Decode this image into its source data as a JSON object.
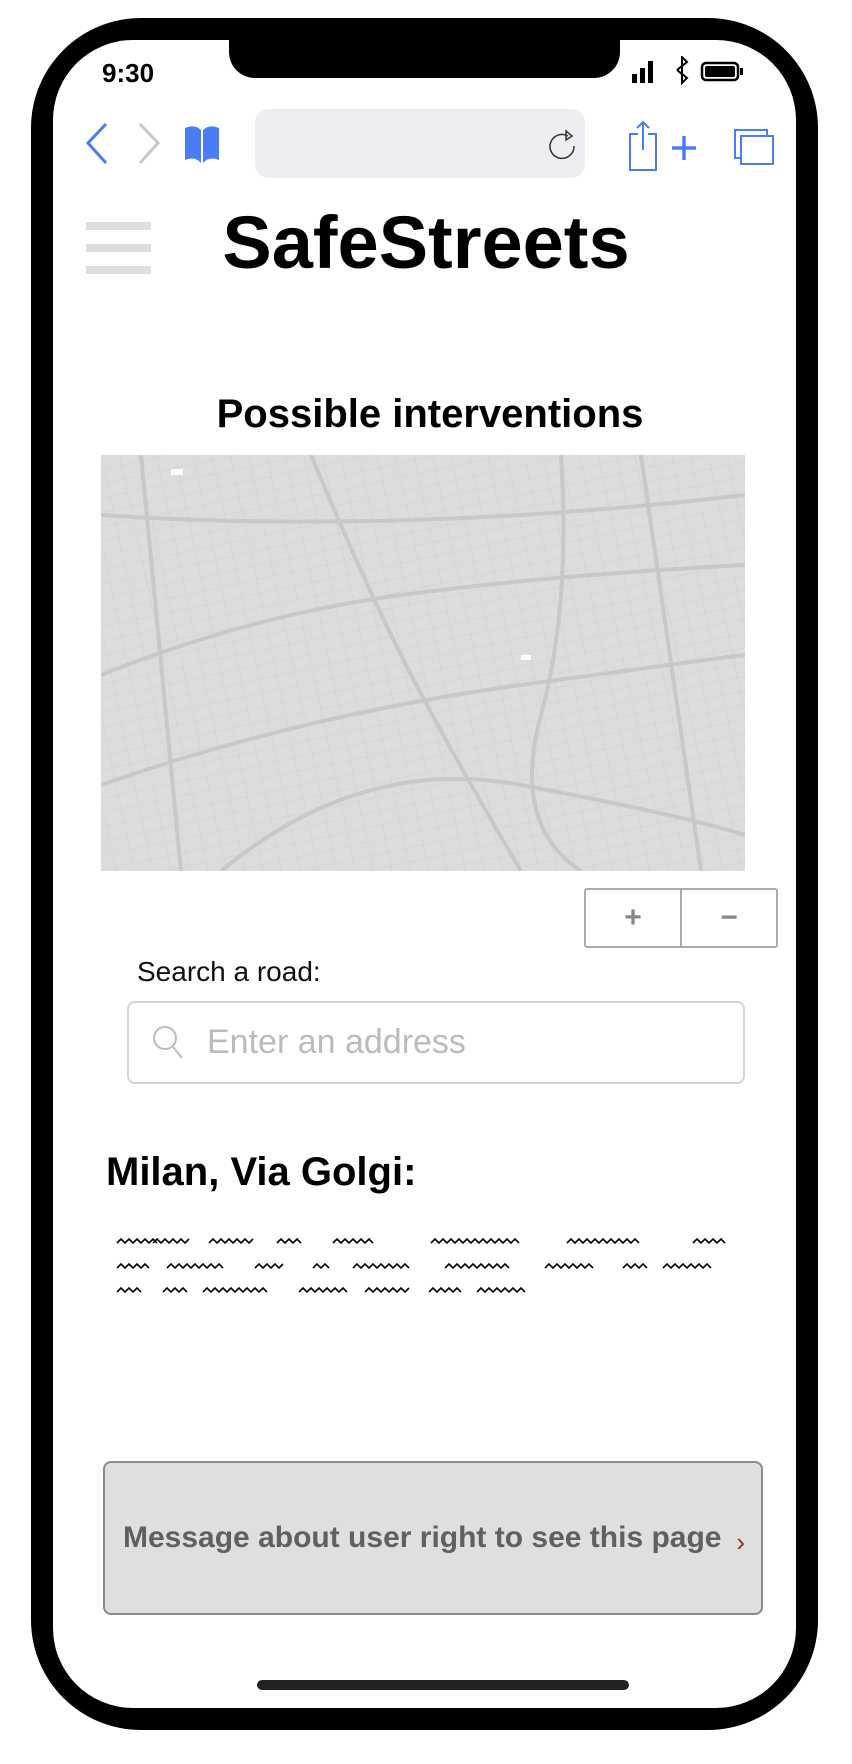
{
  "status_bar": {
    "time": "9:30"
  },
  "browser": {
    "url": ""
  },
  "header": {
    "title": "SafeStreets"
  },
  "main": {
    "section_title": "Possible interventions",
    "map_controls": {
      "zoom_in": "+",
      "zoom_out": "−"
    },
    "search": {
      "label": "Search a road:",
      "placeholder": "Enter an address"
    },
    "road_title": "Milan, Via Golgi:",
    "notice": {
      "text": "Message about user right to see this page",
      "chevron": "›"
    }
  },
  "colors": {
    "accent": "#4a7cf6",
    "map_bg": "#dcdcdc",
    "notice_bg": "#dfdfdf",
    "chevron": "#8b3030"
  }
}
